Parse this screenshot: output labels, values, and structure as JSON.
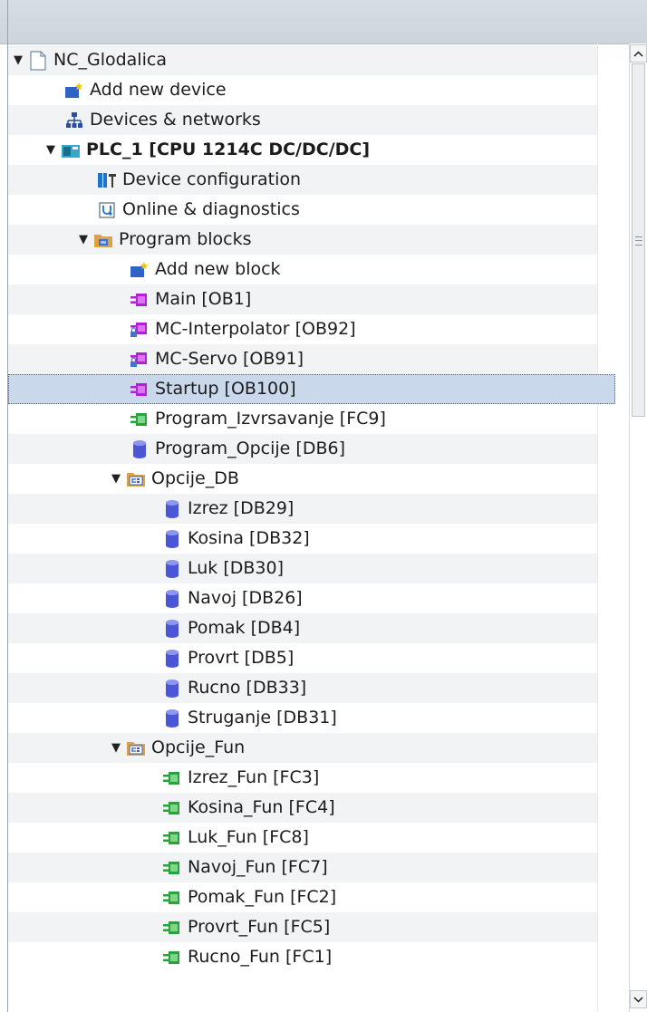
{
  "colors": {
    "selection": "#cad8ec",
    "ob_block": "#b31fd6",
    "fc_block": "#27a33a",
    "db_block": "#4a56d6",
    "folder": "#e0a23c"
  },
  "tree": {
    "items": [
      {
        "label": "NC_Glodalica",
        "icon": "project-icon",
        "caret": "▼"
      },
      {
        "label": "Add new device",
        "icon": "add-device-icon"
      },
      {
        "label": "Devices & networks",
        "icon": "network-icon"
      },
      {
        "label": "PLC_1 [CPU 1214C DC/DC/DC]",
        "icon": "plc-icon",
        "caret": "▼"
      },
      {
        "label": "Device configuration",
        "icon": "device-config-icon"
      },
      {
        "label": "Online & diagnostics",
        "icon": "diagnostics-icon"
      },
      {
        "label": "Program blocks",
        "icon": "folder-blocks-icon",
        "caret": "▼"
      },
      {
        "label": "Add new block",
        "icon": "add-block-icon"
      },
      {
        "label": "Main [OB1]",
        "icon": "ob-block-icon"
      },
      {
        "label": "MC-Interpolator [OB92]",
        "icon": "ob-locked-block-icon"
      },
      {
        "label": "MC-Servo [OB91]",
        "icon": "ob-locked-block-icon"
      },
      {
        "label": "Startup [OB100]",
        "icon": "ob-block-icon"
      },
      {
        "label": "Program_Izvrsavanje [FC9]",
        "icon": "fc-block-icon"
      },
      {
        "label": "Program_Opcije [DB6]",
        "icon": "db-block-icon"
      },
      {
        "label": "Opcije_DB",
        "icon": "group-folder-icon",
        "caret": "▼"
      },
      {
        "label": "Izrez [DB29]",
        "icon": "db-block-icon"
      },
      {
        "label": "Kosina [DB32]",
        "icon": "db-block-icon"
      },
      {
        "label": "Luk [DB30]",
        "icon": "db-block-icon"
      },
      {
        "label": "Navoj [DB26]",
        "icon": "db-block-icon"
      },
      {
        "label": "Pomak [DB4]",
        "icon": "db-block-icon"
      },
      {
        "label": "Provrt [DB5]",
        "icon": "db-block-icon"
      },
      {
        "label": "Rucno [DB33]",
        "icon": "db-block-icon"
      },
      {
        "label": "Struganje [DB31]",
        "icon": "db-block-icon"
      },
      {
        "label": "Opcije_Fun",
        "icon": "group-folder-icon",
        "caret": "▼"
      },
      {
        "label": "Izrez_Fun [FC3]",
        "icon": "fc-block-icon"
      },
      {
        "label": "Kosina_Fun [FC4]",
        "icon": "fc-block-icon"
      },
      {
        "label": "Luk_Fun [FC8]",
        "icon": "fc-block-icon"
      },
      {
        "label": "Navoj_Fun [FC7]",
        "icon": "fc-block-icon"
      },
      {
        "label": "Pomak_Fun [FC2]",
        "icon": "fc-block-icon"
      },
      {
        "label": "Provrt_Fun [FC5]",
        "icon": "fc-block-icon"
      },
      {
        "label": "Rucno_Fun [FC1]",
        "icon": "fc-block-icon"
      }
    ]
  },
  "scrollbar": {
    "up_icon": "chevron-up-icon",
    "down_icon": "chevron-down-icon"
  }
}
